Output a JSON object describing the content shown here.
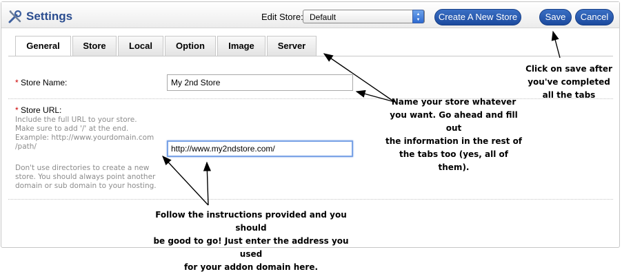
{
  "header": {
    "title": "Settings",
    "logo_icon": "tools-icon",
    "edit_store_label": "Edit Store:",
    "store_select_value": "Default",
    "new_store_button": "Create A New Store",
    "save_button": "Save",
    "cancel_button": "Cancel"
  },
  "tabs": [
    {
      "label": "General",
      "active": true
    },
    {
      "label": "Store",
      "active": false
    },
    {
      "label": "Local",
      "active": false
    },
    {
      "label": "Option",
      "active": false
    },
    {
      "label": "Image",
      "active": false
    },
    {
      "label": "Server",
      "active": false
    }
  ],
  "form": {
    "store_name": {
      "required_mark": "*",
      "label": "Store Name:",
      "value": "My 2nd Store"
    },
    "store_url": {
      "required_mark": "*",
      "label": "Store URL:",
      "help_lines": [
        "Include the full URL to your store.",
        "Make sure to add '/' at the end.",
        "Example: http://www.yourdomain.com",
        "/path/"
      ],
      "help2_lines": [
        "Don't use directories to create a new",
        "store. You should always point another",
        "domain or sub domain to your hosting."
      ],
      "value": "http://www.my2ndstore.com/"
    }
  },
  "annotations": {
    "save_note": [
      "Click on save after",
      "you've completed",
      "all the tabs"
    ],
    "name_note": [
      "Name your store whatever",
      "you want. Go ahead and fill out",
      "the information in the rest of",
      "the tabs too (yes, all of them)."
    ],
    "url_note": [
      "Follow the instructions provided and you should",
      "be good to go! Just enter the address you used",
      "for your addon domain here."
    ]
  },
  "colors": {
    "title": "#2a4c8f",
    "button": "#1c4a9e",
    "required": "#cc0000",
    "focus": "#7aa3e6"
  }
}
